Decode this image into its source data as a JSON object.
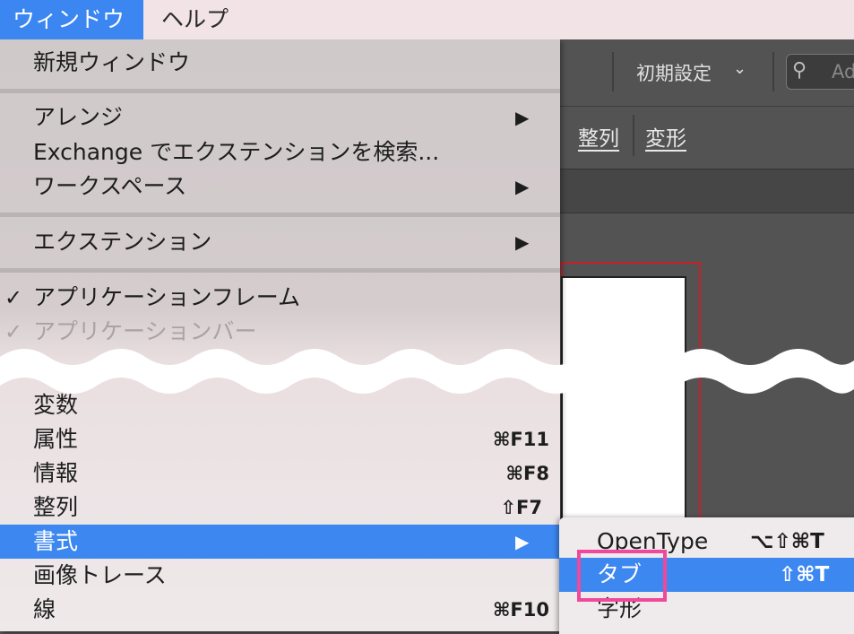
{
  "menubar": {
    "window_label": "ウィンドウ",
    "help_label": "ヘルプ"
  },
  "toolbar": {
    "workspace_label": "初期設定",
    "workspace_chevron": "⌄",
    "search_placeholder": "Ad",
    "align_link": "整列",
    "transform_link": "変形"
  },
  "window_menu": {
    "items_top": [
      {
        "label": "新規ウィンドウ"
      },
      {
        "label": "アレンジ",
        "submenu": true
      },
      {
        "label": "Exchange でエクステンションを検索..."
      },
      {
        "label": "ワークスペース",
        "submenu": true
      },
      {
        "label": "エクステンション",
        "submenu": true
      },
      {
        "label": "アプリケーションフレーム",
        "checked": true
      },
      {
        "label": "アプリケーションバー",
        "checked": true,
        "disabled": true
      }
    ],
    "items_bottom": [
      {
        "label": "変数"
      },
      {
        "label": "属性",
        "shortcut": "⌘F11"
      },
      {
        "label": "情報",
        "shortcut": "⌘F8"
      },
      {
        "label": "整列",
        "shortcut": "⇧F7"
      },
      {
        "label": "書式",
        "submenu": true,
        "highlighted": true
      },
      {
        "label": "画像トレース"
      },
      {
        "label": "線",
        "shortcut": "⌘F10"
      }
    ],
    "check_glyph": "✓",
    "submenu_arrow": "▶"
  },
  "type_submenu": {
    "items": [
      {
        "label": "OpenType",
        "shortcut": "⌥⇧⌘T"
      },
      {
        "label": "タブ",
        "shortcut": "⇧⌘T",
        "highlighted": true
      },
      {
        "label": "字形"
      }
    ]
  },
  "colors": {
    "accent": "#3d87f0",
    "annotation_box": "#f0489a",
    "artboard_border": "#c8202a"
  }
}
